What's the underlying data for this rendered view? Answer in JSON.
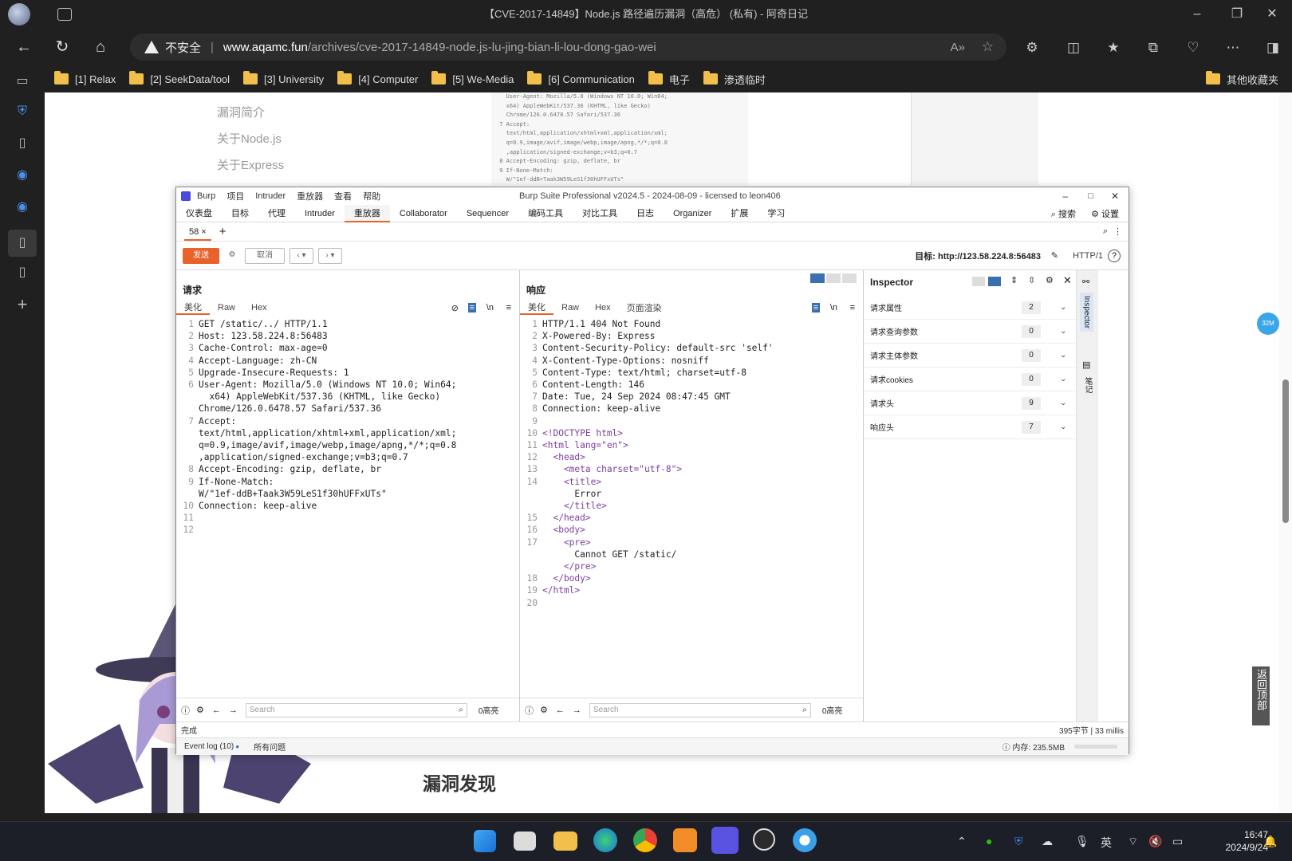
{
  "browser": {
    "window_title": "【CVE-2017-14849】Node.js 路径遍历漏洞（高危） (私有) - 阿奇日记",
    "security_label": "不安全",
    "url_domain": "www.aqamc.fun",
    "url_path": "/archives/cve-2017-14849-node.js-lu-jing-bian-li-lou-dong-gao-wei",
    "bookmarks": [
      "[1] Relax",
      "[2] SeekData/tool",
      "[3] University",
      "[4] Computer",
      "[5] We-Media",
      "[6] Communication",
      "电子",
      "渗透临时"
    ],
    "other_bookmarks": "其他收藏夹"
  },
  "page": {
    "toc": [
      "漏洞简介",
      "关于Node.js",
      "关于Express"
    ],
    "section_heading": "漏洞发现",
    "back_to_top": "返回顶部",
    "bubble": "32M"
  },
  "burp": {
    "title": "Burp Suite Professional v2024.5 - 2024-08-09 - licensed to leon406",
    "menus": [
      "Burp",
      "项目",
      "Intruder",
      "重放器",
      "查看",
      "帮助"
    ],
    "tabs": [
      "仪表盘",
      "目标",
      "代理",
      "Intruder",
      "重放器",
      "Collaborator",
      "Sequencer",
      "编码工具",
      "对比工具",
      "日志",
      "Organizer",
      "扩展",
      "学习"
    ],
    "active_tab": "重放器",
    "search_label": "搜索",
    "settings_label": "设置",
    "subtab": "58",
    "send": "发送",
    "cancel": "取消",
    "target_label": "目标: http://123.58.224.8:56483",
    "http_version": "HTTP/1",
    "request": {
      "title": "请求",
      "view_tabs": [
        "美化",
        "Raw",
        "Hex"
      ],
      "lines": [
        {
          "n": "1",
          "t": "GET /static/../ HTTP/1.1"
        },
        {
          "n": "2",
          "t": "Host: 123.58.224.8:56483"
        },
        {
          "n": "3",
          "t": "Cache-Control: max-age=0"
        },
        {
          "n": "4",
          "t": "Accept-Language: zh-CN"
        },
        {
          "n": "5",
          "t": "Upgrade-Insecure-Requests: 1"
        },
        {
          "n": "6",
          "t": "User-Agent: Mozilla/5.0 (Windows NT 10.0; Win64;"
        },
        {
          "n": "",
          "t": "  x64) AppleWebKit/537.36 (KHTML, like Gecko)"
        },
        {
          "n": "",
          "t": "Chrome/126.0.6478.57 Safari/537.36"
        },
        {
          "n": "7",
          "t": "Accept:"
        },
        {
          "n": "",
          "t": "text/html,application/xhtml+xml,application/xml;"
        },
        {
          "n": "",
          "t": "q=0.9,image/avif,image/webp,image/apng,*/*;q=0.8"
        },
        {
          "n": "",
          "t": ",application/signed-exchange;v=b3;q=0.7"
        },
        {
          "n": "8",
          "t": "Accept-Encoding: gzip, deflate, br"
        },
        {
          "n": "9",
          "t": "If-None-Match:"
        },
        {
          "n": "",
          "t": "W/\"1ef-ddB+Taak3W59LeS1f30hUFFxUTs\""
        },
        {
          "n": "10",
          "t": "Connection: keep-alive"
        },
        {
          "n": "11",
          "t": ""
        },
        {
          "n": "12",
          "t": ""
        }
      ],
      "search_placeholder": "Search",
      "highlights": "0高亮"
    },
    "response": {
      "title": "响应",
      "view_tabs": [
        "美化",
        "Raw",
        "Hex",
        "页面渲染"
      ],
      "lines": [
        {
          "n": "1",
          "t": "HTTP/1.1 404 Not Found"
        },
        {
          "n": "2",
          "t": "X-Powered-By: Express"
        },
        {
          "n": "3",
          "t": "Content-Security-Policy: default-src 'self'"
        },
        {
          "n": "4",
          "t": "X-Content-Type-Options: nosniff"
        },
        {
          "n": "5",
          "t": "Content-Type: text/html; charset=utf-8"
        },
        {
          "n": "6",
          "t": "Content-Length: 146"
        },
        {
          "n": "7",
          "t": "Date: Tue, 24 Sep 2024 08:47:45 GMT"
        },
        {
          "n": "8",
          "t": "Connection: keep-alive"
        },
        {
          "n": "9",
          "t": ""
        },
        {
          "n": "10",
          "t": "<!DOCTYPE html>"
        },
        {
          "n": "11",
          "t": "<html lang=\"en\">"
        },
        {
          "n": "12",
          "t": "  <head>"
        },
        {
          "n": "13",
          "t": "    <meta charset=\"utf-8\">"
        },
        {
          "n": "14",
          "t": "    <title>"
        },
        {
          "n": "",
          "t": "      Error"
        },
        {
          "n": "",
          "t": "    </title>"
        },
        {
          "n": "15",
          "t": "  </head>"
        },
        {
          "n": "16",
          "t": "  <body>"
        },
        {
          "n": "17",
          "t": "    <pre>"
        },
        {
          "n": "",
          "t": "      Cannot GET /static/"
        },
        {
          "n": "",
          "t": "    </pre>"
        },
        {
          "n": "18",
          "t": "  </body>"
        },
        {
          "n": "19",
          "t": "</html>"
        },
        {
          "n": "20",
          "t": ""
        }
      ],
      "search_placeholder": "Search",
      "highlights": "0高亮"
    },
    "inspector": {
      "title": "Inspector",
      "rows": [
        {
          "label": "请求属性",
          "count": "2"
        },
        {
          "label": "请求查询参数",
          "count": "0"
        },
        {
          "label": "请求主体参数",
          "count": "0"
        },
        {
          "label": "请求cookies",
          "count": "0"
        },
        {
          "label": "请求头",
          "count": "9"
        },
        {
          "label": "响应头",
          "count": "7"
        }
      ],
      "vertical_label": "Inspector",
      "vertical_label2": "笔记"
    },
    "status_left": "完成",
    "status_right": "395字节 | 33 millis",
    "event_log": "Event log (10)",
    "all_issues": "所有问题",
    "memory": "内存: 235.5MB"
  },
  "taskbar": {
    "ime": "英",
    "time": "16:47",
    "date": "2024/9/24"
  }
}
